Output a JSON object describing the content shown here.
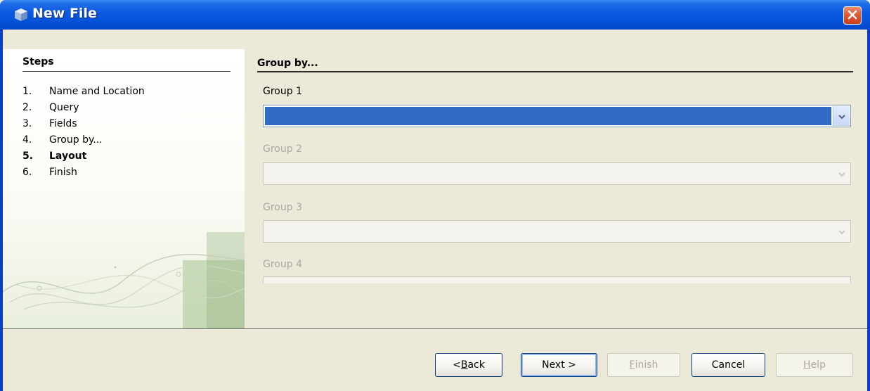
{
  "window": {
    "title": "New File",
    "close_label": "✕"
  },
  "steps": {
    "heading": "Steps",
    "items": [
      {
        "num": "1.",
        "label": "Name and Location"
      },
      {
        "num": "2.",
        "label": "Query"
      },
      {
        "num": "3.",
        "label": "Fields"
      },
      {
        "num": "4.",
        "label": "Group by..."
      },
      {
        "num": "5.",
        "label": "Layout",
        "current": true
      },
      {
        "num": "6.",
        "label": "Finish"
      }
    ]
  },
  "panel": {
    "heading": "Group by...",
    "groups": [
      {
        "label": "Group 1",
        "value": "",
        "enabled": true,
        "selected": true
      },
      {
        "label": "Group 2",
        "value": "",
        "enabled": false
      },
      {
        "label": "Group 3",
        "value": "",
        "enabled": false
      },
      {
        "label": "Group 4",
        "value": "",
        "enabled": false
      }
    ]
  },
  "buttons": {
    "back": {
      "pre": "< ",
      "mnemonic": "B",
      "post": "ack",
      "enabled": true
    },
    "next": {
      "label": "Next >",
      "enabled": true,
      "default": true
    },
    "finish": {
      "mnemonic": "F",
      "post": "inish",
      "enabled": false
    },
    "cancel": {
      "label": "Cancel",
      "enabled": true
    },
    "help": {
      "mnemonic": "H",
      "post": "elp",
      "enabled": false
    }
  },
  "colors": {
    "titlebar": "#0a58e0",
    "selection": "#316ac5",
    "dialog_bg": "#ece9d8",
    "close_button": "#e0562f"
  },
  "icons": {
    "window": "netbeans-cube-icon",
    "close": "close-icon",
    "dropdown": "chevron-down-icon"
  }
}
